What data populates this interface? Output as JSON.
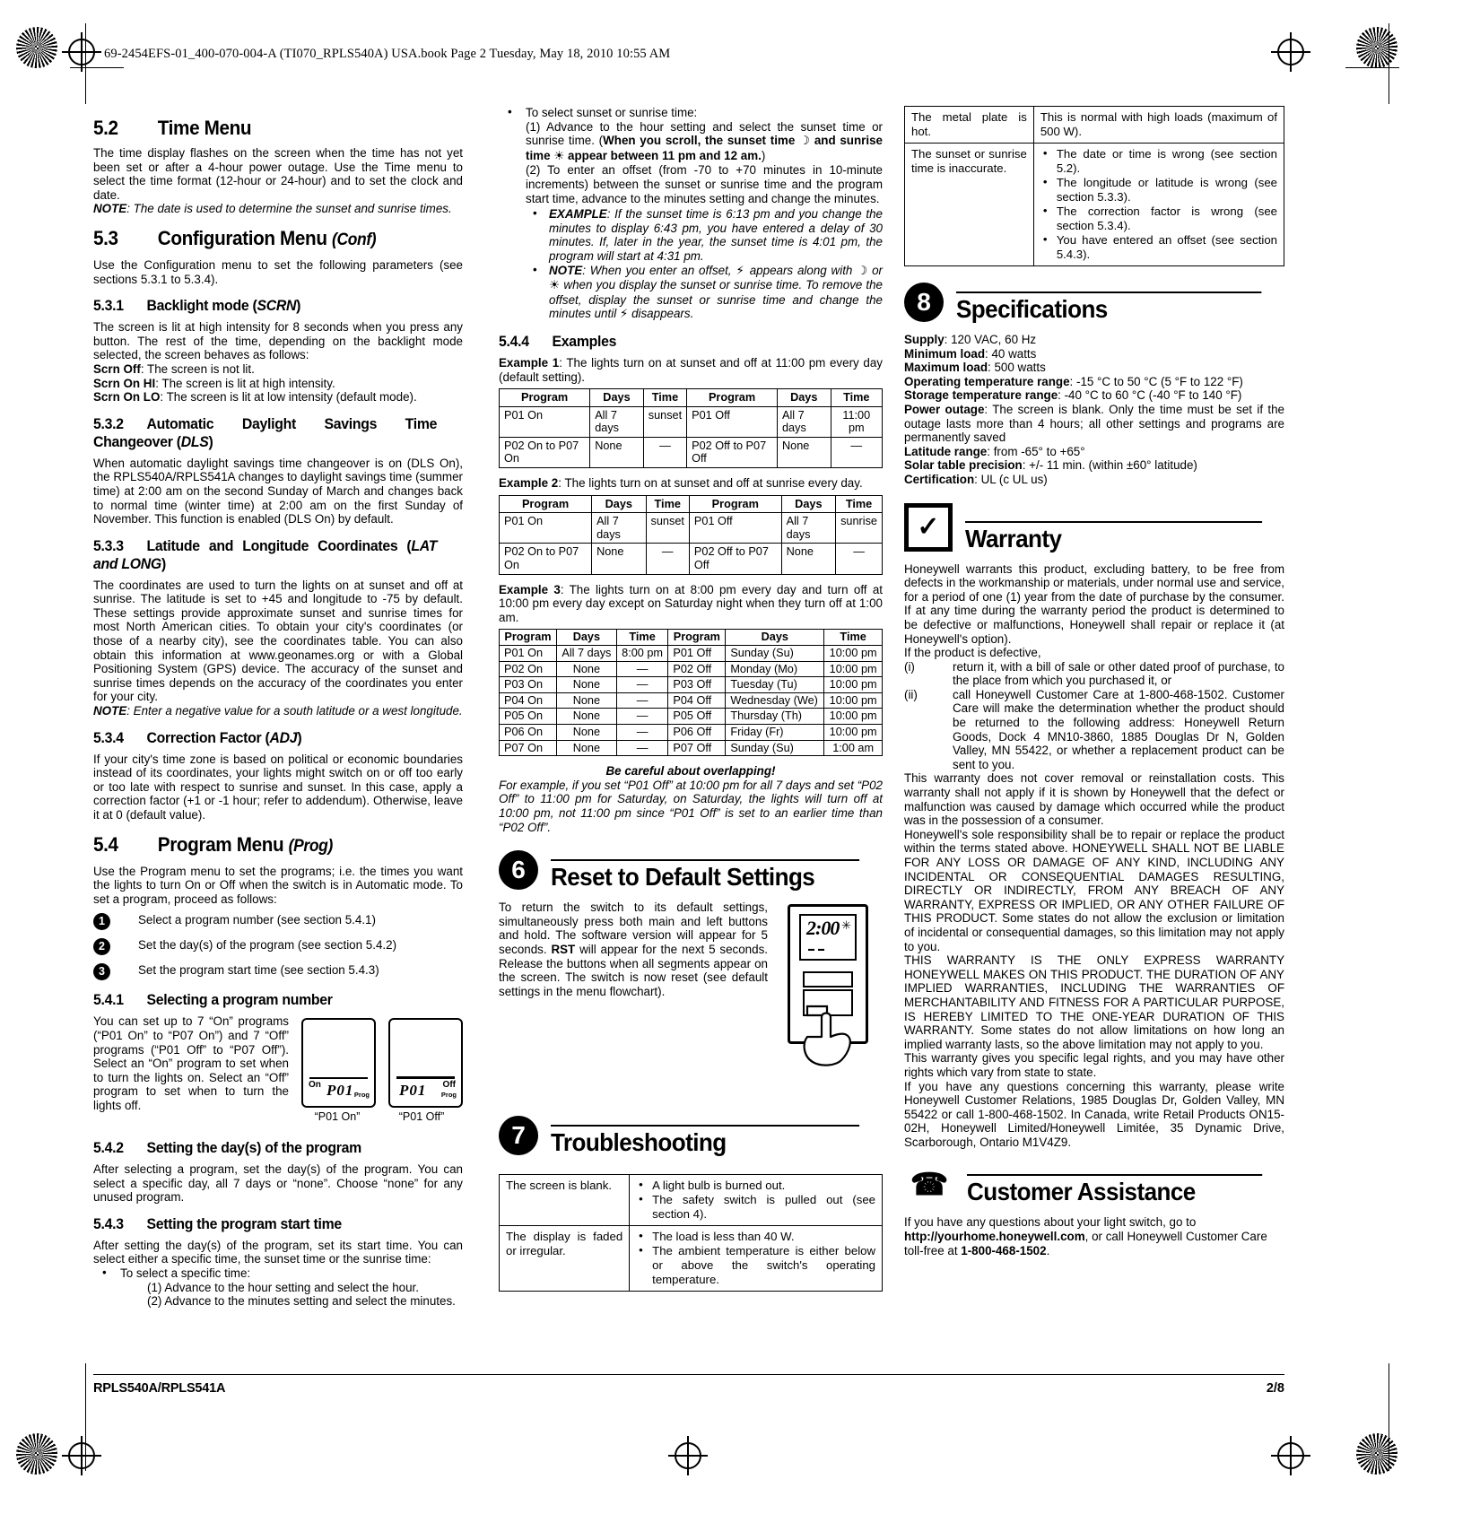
{
  "header": {
    "book_line": "69-2454EFS-01_400-070-004-A (TI070_RPLS540A) USA.book  Page 2  Tuesday, May 18, 2010  10:55 AM"
  },
  "footer": {
    "model": "RPLS540A/RPLS541A",
    "page": "2/8"
  },
  "col1": {
    "s52_num": "5.2",
    "s52_title": "Time Menu",
    "s52_p1": "The time display flashes on the screen when the time has not yet been set or after a 4-hour power outage. Use the Time menu to select the time format (12-hour or 24-hour) and to set the clock and date.",
    "s52_note_label": "NOTE",
    "s52_note_text": ": The date is used to determine the sunset and sunrise times.",
    "s53_num": "5.3",
    "s53_title": "Configuration Menu",
    "s53_title_ital": "(Conf)",
    "s53_p1": "Use the Configuration menu to set the following parameters (see sections 5.3.1 to 5.3.4).",
    "s531_num": "5.3.1",
    "s531_title": "Backlight mode (",
    "s531_title_ital": "SCRN",
    "s531_title_end": ")",
    "s531_p1": "The screen is lit at high intensity for 8 seconds when you press any button. The rest of the time, depending on the backlight mode selected, the screen behaves as follows:",
    "s531_off_b": "Scrn Off",
    "s531_off_t": ": The screen is not lit.",
    "s531_hi_b": "Scrn On HI",
    "s531_hi_t": ": The screen is lit at high intensity.",
    "s531_lo_b": "Scrn On LO",
    "s531_lo_t": ": The screen is lit at low intensity (default mode).",
    "s532_num": "5.3.2",
    "s532_title": "Automatic Daylight Savings Time Changeover (",
    "s532_title_ital": "DLS",
    "s532_title_end": ")",
    "s532_p1": "When automatic daylight savings time changeover is on (DLS On), the RPLS540A/RPLS541A changes to daylight savings time (summer time) at 2:00 am on the second Sunday of March and changes back to normal time (winter time) at 2:00 am on the first Sunday of November. This function is enabled (DLS On) by default.",
    "s533_num": "5.3.3",
    "s533_title": "Latitude and Longitude Coordinates (",
    "s533_title_ital": "LAT and LONG",
    "s533_title_end": ")",
    "s533_p1": "The coordinates are used to turn the lights on at sunset and off at sunrise. The latitude is set to +45 and longitude to -75 by default. These settings provide approximate sunset and sunrise times for most North American cities. To obtain your city's coordinates (or those of a nearby city), see the coordinates table. You can also obtain this information at www.geonames.org or with a Global Positioning System (GPS) device. The accuracy of the sunset and sunrise times depends on the accuracy of the coordinates you enter for your city.",
    "s533_note_label": "NOTE",
    "s533_note_text": ": Enter a negative value for a south latitude or a west longitude.",
    "s534_num": "5.3.4",
    "s534_title": "Correction Factor (",
    "s534_title_ital": "ADJ",
    "s534_title_end": ")",
    "s534_p1": "If your city's time zone is based on political or economic boundaries instead of its coordinates, your lights might switch on or off too early or too late with respect to sunrise and sunset. In this case, apply a correction factor (+1 or -1 hour; refer to addendum). Otherwise, leave it at 0 (default value).",
    "s54_num": "5.4",
    "s54_title": "Program Menu",
    "s54_title_ital": "(Prog)",
    "s54_p1": "Use the Program menu to set the programs; i.e. the times you want the lights to turn On or Off when the switch is in Automatic mode. To set a program, proceed as follows:",
    "steps": [
      {
        "n": "1",
        "text": "Select a program number (see section 5.4.1)"
      },
      {
        "n": "2",
        "text": "Set the day(s) of the program (see section 5.4.2)"
      },
      {
        "n": "3",
        "text": "Set the program start time (see section 5.4.3)"
      }
    ],
    "s541_num": "5.4.1",
    "s541_title": "Selecting a program number",
    "s541_p1": "You can set up to 7 “On” programs (“P01 On” to “P07 On”) and 7 “Off” programs (“P01 Off” to “P07 Off”). Select an “On” program to set when to turn the lights on. Select an “Off” program to set when to turn the lights off.",
    "lcd_left_on": "On",
    "lcd_left_code": "P01",
    "lcd_left_prog": "Prog",
    "lcd_left_caption": "“P01 On”",
    "lcd_right_code": "P01",
    "lcd_right_off": "Off",
    "lcd_right_prog": "Prog",
    "lcd_right_caption": "“P01 Off”",
    "s542_num": "5.4.2",
    "s542_title": "Setting the day(s) of the program",
    "s542_p1": "After selecting a program, set the day(s) of the program. You can select a specific day, all 7 days or “none”. Choose “none” for any unused program.",
    "s543_num": "5.4.3",
    "s543_title": "Setting the program start time",
    "s543_p1": "After setting the day(s) of the program, set its start time. You can select either a specific time, the sunset time or the sunrise time:",
    "s543_b1": "To select a specific time:",
    "s543_b1_l1": "(1) Advance to the hour setting and select the hour.",
    "s543_b1_l2": "(2) Advance to the minutes setting and select the minutes."
  },
  "col2": {
    "b2_head": "To select sunset or sunrise time:",
    "b2_l1": "(1) Advance to the hour setting and select the sunset time or sunrise time. (",
    "b2_l1_bold_a": "When you scroll, the sunset time",
    "b2_moon_icon": "moon-icon",
    "b2_l1_bold_b": "and sunrise time",
    "b2_sun_icon": "sun-icon",
    "b2_l1_bold_c": "appear between 11 pm and 12 am.",
    "b2_l1_end": ")",
    "b2_l2": "(2) To enter an offset (from -70 to +70 minutes in 10-minute increments) between the sunset or sunrise time and the program start time, advance to the minutes setting and change the minutes.",
    "ex_label": "EXAMPLE",
    "ex_text": ": If the sunset time is 6:13 pm and you change the minutes to display 6:43 pm, you have entered a delay of 30 minutes. If, later in the year, the sunset time is 4:01 pm, the program will start at 4:31 pm.",
    "note_label": "NOTE",
    "note_t1": ": When you enter an offset,",
    "note_bolt_icon": "lightning-icon",
    "note_t2": "appears along with",
    "note_moon_icon": "moon-icon",
    "note_t3": "or",
    "note_sun_icon": "sun-icon",
    "note_t4": "when you display the sunset or sunrise time. To remove the offset, display the sunset or sunrise time and change the minutes until",
    "note_bolt_icon2": "lightning-icon",
    "note_t5": "disappears.",
    "s544_num": "5.4.4",
    "s544_title": "Examples",
    "ex1_label": "Example 1",
    "ex1_text": ": The lights turn on at sunset and off at 11:00 pm every day (default setting).",
    "table1": {
      "headers": [
        "Program",
        "Days",
        "Time",
        "Program",
        "Days",
        "Time"
      ],
      "rows": [
        [
          "P01 On",
          "All 7 days",
          "sunset",
          "P01 Off",
          "All 7 days",
          "11:00 pm"
        ],
        [
          "P02 On to P07 On",
          "None",
          "—",
          "P02 Off to P07 Off",
          "None",
          "—"
        ]
      ]
    },
    "ex2_label": "Example 2",
    "ex2_text": ": The lights turn on at sunset and off at sunrise every day.",
    "table2": {
      "headers": [
        "Program",
        "Days",
        "Time",
        "Program",
        "Days",
        "Time"
      ],
      "rows": [
        [
          "P01 On",
          "All 7 days",
          "sunset",
          "P01 Off",
          "All 7 days",
          "sunrise"
        ],
        [
          "P02 On to P07 On",
          "None",
          "—",
          "P02 Off to P07 Off",
          "None",
          "—"
        ]
      ]
    },
    "ex3_label": "Example 3",
    "ex3_text": ": The lights turn on at 8:00 pm every day and turn off at 10:00 pm every day except on Saturday night when they turn off at 1:00 am.",
    "table3": {
      "headers": [
        "Program",
        "Days",
        "Time",
        "Program",
        "Days",
        "Time"
      ],
      "rows": [
        [
          "P01 On",
          "All 7 days",
          "8:00 pm",
          "P01 Off",
          "Sunday (Su)",
          "10:00 pm"
        ],
        [
          "P02 On",
          "None",
          "—",
          "P02 Off",
          "Monday (Mo)",
          "10:00 pm"
        ],
        [
          "P03 On",
          "None",
          "—",
          "P03 Off",
          "Tuesday (Tu)",
          "10:00 pm"
        ],
        [
          "P04 On",
          "None",
          "—",
          "P04 Off",
          "Wednesday (We)",
          "10:00 pm"
        ],
        [
          "P05 On",
          "None",
          "—",
          "P05 Off",
          "Thursday (Th)",
          "10:00 pm"
        ],
        [
          "P06 On",
          "None",
          "—",
          "P06 Off",
          "Friday (Fr)",
          "10:00 pm"
        ],
        [
          "P07 On",
          "None",
          "—",
          "P07 Off",
          "Sunday (Su)",
          "1:00 am"
        ]
      ]
    },
    "overlap_title": "Be careful about overlapping!",
    "overlap_text": "For example, if you set “P01 Off” at 10:00 pm for all 7 days and set “P02 Off” to 11:00 pm for Saturday, on Saturday, the lights will turn off at 10:00 pm, not 11:00 pm since “P01 Off” is set to an earlier time than “P02 Off”.",
    "s6_badge": "6",
    "s6_title": "Reset to Default Settings",
    "s6_p1a": "To return the switch to its default settings, simultaneously press both main and left buttons and hold. The software version will appear for 5 seconds. ",
    "s6_rst": "RST",
    "s6_p1b": " will appear for the next 5 seconds. Release the buttons when all segments appear on the screen. The switch is now reset  (see default settings in the menu flowchart).",
    "switch_display": "2:00",
    "s7_badge": "7",
    "s7_title": "Troubleshooting",
    "tshoot": [
      {
        "problem": "The screen is blank.",
        "causes": [
          "A light bulb is burned out.",
          "The safety switch is pulled out (see section 4)."
        ]
      },
      {
        "problem": "The display is faded or irregular.",
        "causes": [
          "The load is less than 40 W.",
          "The ambient temperature is either below or above the switch's operating temperature."
        ]
      }
    ]
  },
  "col3": {
    "tshoot": [
      {
        "problem": "The metal plate is hot.",
        "causes": [
          "This is normal with high loads (maximum of 500 W)."
        ],
        "bulleted": false
      },
      {
        "problem": "The sunset or sunrise time is inaccurate.",
        "causes": [
          "The date or time is wrong (see section 5.2).",
          "The longitude or latitude is wrong (see section 5.3.3).",
          "The correction factor is wrong (see section 5.3.4).",
          "You have entered an offset (see section 5.4.3)."
        ],
        "bulleted": true
      }
    ],
    "s8_badge": "8",
    "s8_title": "Specifications",
    "specs": [
      {
        "label": "Supply",
        "value": ": 120 VAC, 60 Hz"
      },
      {
        "label": "Minimum load",
        "value": ": 40 watts"
      },
      {
        "label": "Maximum load",
        "value": ": 500 watts"
      },
      {
        "label": "Operating temperature range",
        "value": ": -15 °C to 50 °C (5 °F to 122 °F)"
      },
      {
        "label": "Storage temperature range",
        "value": ": -40 °C to 60 °C (-40 °F to 140 °F)"
      },
      {
        "label": "Power outage",
        "value": ": The screen is blank. Only the time must be set if the outage lasts more than 4 hours; all other settings and programs are permanently saved"
      },
      {
        "label": "Latitude range",
        "value": ": from -65° to +65°"
      },
      {
        "label": "Solar table precision",
        "value": ": +/- 11 min. (within ±60° latitude)"
      },
      {
        "label": "Certification",
        "value": ": UL (c UL us)"
      }
    ],
    "warranty_badge": "✓",
    "warranty_title": "Warranty",
    "w_p1": "Honeywell warrants this product, excluding battery, to be free from defects in the workmanship or materials, under normal use and service, for a period of one (1) year from the date of purchase by the consumer. If at any time during the warranty period the product is determined to be defective or malfunctions, Honeywell shall repair or replace it (at Honeywell's option).",
    "w_p2": "If the product is defective,",
    "w_i_num": "(i)",
    "w_i_text": "return it, with a bill of sale or other dated proof of purchase, to the place from which you purchased it, or",
    "w_ii_num": "(ii)",
    "w_ii_text": "call Honeywell Customer Care at 1-800-468-1502.   Customer Care will make the determination whether the product should be returned to the following address: Honeywell Return Goods, Dock 4   MN10-3860, 1885 Douglas Dr N, Golden Valley, MN 55422, or whether a replacement product can be sent to you.",
    "w_p3": "This warranty does not cover removal or reinstallation costs. This warranty shall not apply if it is shown by Honeywell that the defect or malfunction was caused by damage which occurred while the product was in the possession of a consumer.",
    "w_p4": "Honeywell's sole responsibility shall be to repair or replace the product within the terms stated above. HONEYWELL SHALL NOT BE LIABLE FOR ANY LOSS OR DAMAGE OF ANY KIND, INCLUDING ANY INCIDENTAL OR CONSEQUENTIAL DAMAGES RESULTING, DIRECTLY OR INDIRECTLY, FROM ANY BREACH OF ANY WARRANTY, EXPRESS OR IMPLIED, OR ANY OTHER FAILURE OF THIS PRODUCT. Some states do not allow the exclusion or limitation of incidental or consequential damages, so this limitation may not apply to you.",
    "w_p5": "THIS WARRANTY IS THE ONLY EXPRESS WARRANTY HONEYWELL MAKES ON THIS PRODUCT. THE DURATION OF ANY IMPLIED WARRANTIES, INCLUDING THE WARRANTIES OF MERCHANTABILITY AND FITNESS FOR A PARTICULAR PURPOSE, IS HEREBY LIMITED TO THE ONE-YEAR DURATION OF THIS WARRANTY. Some states do not allow limitations on how long an implied warranty lasts, so the above limitation may not apply to you.",
    "w_p6": "This warranty gives you specific legal rights, and you may have other rights which vary from state to state.",
    "w_p7": "If you have any questions concerning this warranty, please write Honeywell Customer Relations, 1985 Douglas Dr, Golden Valley, MN 55422 or call 1-800-468-1502. In Canada, write Retail Products ON15-02H, Honeywell Limited/Honeywell Limitée, 35 Dynamic Drive, Scarborough, Ontario M1V4Z9.",
    "ca_badge": "☎",
    "ca_title": "Customer Assistance",
    "ca_p1a": "If you have any questions about your light switch, go to ",
    "ca_url": "http://yourhome.honeywell.com",
    "ca_p1b": ", or call Honeywell Customer Care toll-free at ",
    "ca_phone": "1-800-468-1502",
    "ca_p1c": "."
  }
}
